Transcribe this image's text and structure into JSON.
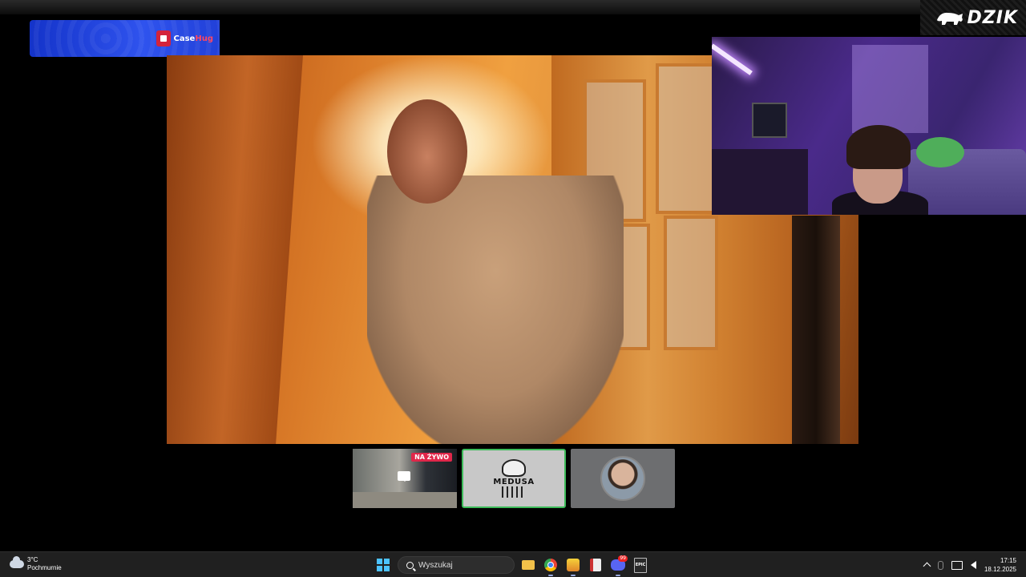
{
  "overlay": {
    "brand": "DZIK",
    "sponsor_prefix": "Case",
    "sponsor_suffix": "Hug"
  },
  "thumbnails": [
    {
      "badge": "NA ŻYWO"
    },
    {
      "label": "MEDUSA"
    },
    {}
  ],
  "taskbar": {
    "weather_temp": "3°C",
    "weather_desc": "Pochmurnie",
    "search_placeholder": "Wyszukaj",
    "epic_label": "EPIC",
    "discord_badge": "99",
    "time": "17:15",
    "date": "18.12.2025"
  }
}
